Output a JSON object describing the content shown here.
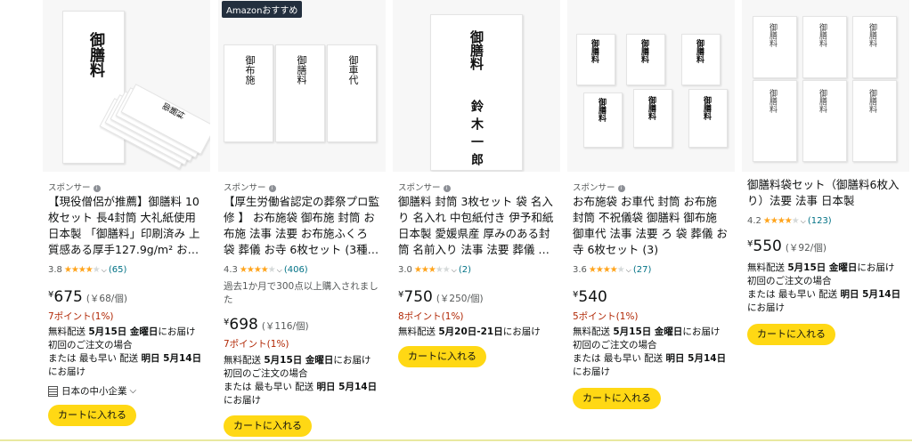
{
  "products": [
    {
      "badge": "",
      "image_labels": [
        "御膳料",
        "御膳料"
      ],
      "sponsor": "スポンサー",
      "title": "【現役僧侶が推薦】御膳料 10枚セット 長4封筒 大礼紙使用 日本製 「御膳料」印刷済み 上質感ある厚手127.9g/m² お…",
      "rating": "3.8",
      "stars": "★★★★☆",
      "reviews": "(65)",
      "bought": "",
      "yen": "¥",
      "price": "675",
      "unit_price": "(￥68/個)",
      "points": "7ポイント(1%)",
      "delivery_free": "無料配送",
      "delivery_date": "5月15日 金曜日",
      "delivery_suffix": "にお届け",
      "delivery_first": "初回のご注文の場合",
      "fastest_pre": "または 最も早い 配送",
      "fastest_date": "明日 5月14日",
      "fastest_suffix": "にお届け",
      "seller": "日本の中小企業",
      "cart": "カートに入れる"
    },
    {
      "badge": "Amazonおすすめ",
      "image_labels": [
        "御布施",
        "御膳料",
        "御車代"
      ],
      "sponsor": "スポンサー",
      "title": "【厚生労働省認定の葬祭プロ監修 】 お布施袋 御布施 封筒 お布施 法事 法要 お布施ふくろ 袋 葬儀 お寺 6枚セット (3種…",
      "rating": "4.3",
      "stars": "★★★★☆",
      "reviews": "(406)",
      "bought": "過去1か月で300点以上購入されました",
      "yen": "¥",
      "price": "698",
      "unit_price": "(￥116/個)",
      "points": "7ポイント(1%)",
      "delivery_free": "無料配送",
      "delivery_date": "5月15日 金曜日",
      "delivery_suffix": "にお届け",
      "delivery_first": "初回のご注文の場合",
      "fastest_pre": "または 最も早い 配送",
      "fastest_date": "明日 5月14日",
      "fastest_suffix": "にお届け",
      "seller": "",
      "cart": "カートに入れる"
    },
    {
      "badge": "",
      "image_labels": [
        "御膳料",
        "鈴木一郎"
      ],
      "sponsor": "スポンサー",
      "title": "御膳料 封筒 3枚セット 袋 名入り 名入れ 中包紙付き 伊予和紙 日本製 愛媛県産 厚みのある封筒 名前入り 法事 法要 葬儀 …",
      "rating": "3.0",
      "stars": "★★★☆☆",
      "reviews": "(2)",
      "bought": "",
      "yen": "¥",
      "price": "750",
      "unit_price": "(￥250/個)",
      "points": "8ポイント(1%)",
      "delivery_free": "無料配送",
      "delivery_date": "5月20日-21日",
      "delivery_suffix": "にお届け",
      "delivery_first": "",
      "fastest_pre": "",
      "fastest_date": "",
      "fastest_suffix": "",
      "seller": "",
      "cart": "カートに入れる"
    },
    {
      "badge": "",
      "image_labels": [
        "御膳料"
      ],
      "sponsor": "スポンサー",
      "title": "お布施袋 お車代 封筒 お布施 封筒 不祝儀袋 御膳料 御布施 御車代 法事 法要 ろ 袋 葬儀 お寺 6枚セット (3)",
      "rating": "3.6",
      "stars": "★★★★☆",
      "reviews": "(27)",
      "bought": "",
      "yen": "¥",
      "price": "540",
      "unit_price": "",
      "points": "5ポイント(1%)",
      "delivery_free": "無料配送",
      "delivery_date": "5月15日 金曜日",
      "delivery_suffix": "にお届け",
      "delivery_first": "初回のご注文の場合",
      "fastest_pre": "または 最も早い 配送",
      "fastest_date": "明日 5月14日",
      "fastest_suffix": "にお届け",
      "seller": "",
      "cart": "カートに入れる"
    },
    {
      "badge": "",
      "image_labels": [
        "御膳料"
      ],
      "sponsor": "",
      "title": "御膳料袋セット（御膳料6枚入り）法要 法事 日本製",
      "rating": "4.2",
      "stars": "★★★★☆",
      "reviews": "(123)",
      "bought": "",
      "yen": "¥",
      "price": "550",
      "unit_price": "(￥92/個)",
      "points": "",
      "delivery_free": "無料配送",
      "delivery_date": "5月15日 金曜日",
      "delivery_suffix": "にお届け",
      "delivery_first": "初回のご注文の場合",
      "fastest_pre": "または 最も早い 配送",
      "fastest_date": "明日 5月14日",
      "fastest_suffix": "にお届け",
      "seller": "",
      "cart": "カートに入れる"
    }
  ]
}
